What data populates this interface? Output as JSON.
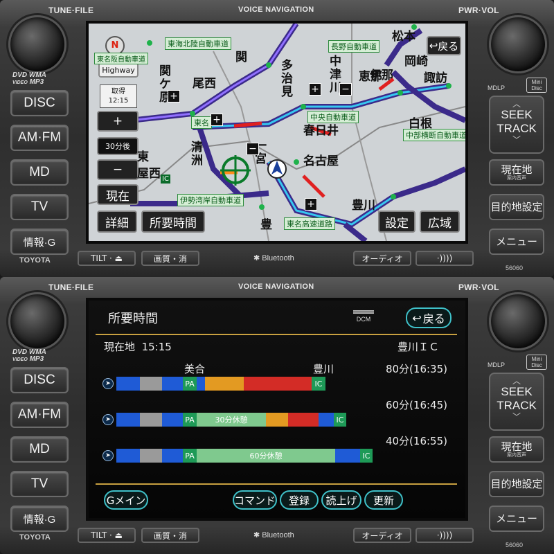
{
  "device": {
    "tune_file": "TUNE·FILE",
    "voice_navigation": "VOICE NAVIGATION",
    "pwr_vol": "PWR·VOL",
    "brand": "TOYOTA",
    "model": "56060",
    "logos": {
      "dvd": "DVD",
      "wma": "WMA",
      "video": "VIDEO",
      "mp3": "MP3",
      "mdlp": "MDLP",
      "minidisc": "Mini Disc"
    },
    "left_buttons": [
      "DISC",
      "AM·FM",
      "MD",
      "TV",
      "情報·G"
    ],
    "seek_track": [
      "SEEK",
      "TRACK"
    ],
    "right_buttons": [
      {
        "label": "現在地",
        "sub": "案内音声"
      },
      {
        "label": "目的地設定",
        "sub": ""
      },
      {
        "label": "メニュー",
        "sub": ""
      }
    ],
    "bottom_buttons": [
      "TILT · ⏏",
      "画質・消",
      "オーディオ",
      "·))))"
    ],
    "bluetooth": "Bluetooth"
  },
  "map": {
    "back": "戻る",
    "highway": "Highway",
    "acquired": "取得",
    "acquired_time": "12:15",
    "zoom_in": "+",
    "zoom_out": "−",
    "scale": "30分後",
    "current": "現在",
    "detail": "詳細",
    "travel_time": "所要時間",
    "settings": "設定",
    "wide_area": "広域",
    "expressway_labels": [
      "東海北陸自動車道",
      "長野自動車道",
      "中央自動車道",
      "中部横断自動車道",
      "伊勢湾岸自動車道",
      "東名高速道路",
      "東名",
      "東名阪自動車道"
    ],
    "places": [
      "関",
      "関ケ原",
      "尾西",
      "多治見",
      "中津川",
      "恵那",
      "岡崎",
      "諏訪",
      "白根",
      "春日井",
      "名古屋",
      "清洲",
      "豊川",
      "豊",
      "屋西",
      "東",
      "一宮",
      "松本",
      "伊那"
    ],
    "ic_tag": "IC"
  },
  "route": {
    "title": "所要時間",
    "dcm": "DCM",
    "back": "戻る",
    "current_label": "現在地",
    "current_time": "15:15",
    "destination": "豊川ＩＣ",
    "waypoint_label": "美合",
    "end_label": "豊川",
    "routes": [
      {
        "duration": "80分(16:35)",
        "rest": ""
      },
      {
        "duration": "60分(16:45)",
        "rest": "30分休憩"
      },
      {
        "duration": "40分(16:55)",
        "rest": "60分休憩"
      }
    ],
    "pa_tag": "PA",
    "ic_tag": "IC",
    "colors": {
      "blue": "#1f5bd6",
      "gray": "#9a9a9a",
      "green": "#1e9a57",
      "orange": "#e39a22",
      "red": "#d32c26",
      "rest_green": "#7fc98e",
      "accent": "#3fc1c9"
    },
    "buttons": {
      "g_main": "Gメイン",
      "command": "コマンド",
      "register": "登録",
      "read_aloud": "読上げ",
      "update": "更新"
    }
  }
}
